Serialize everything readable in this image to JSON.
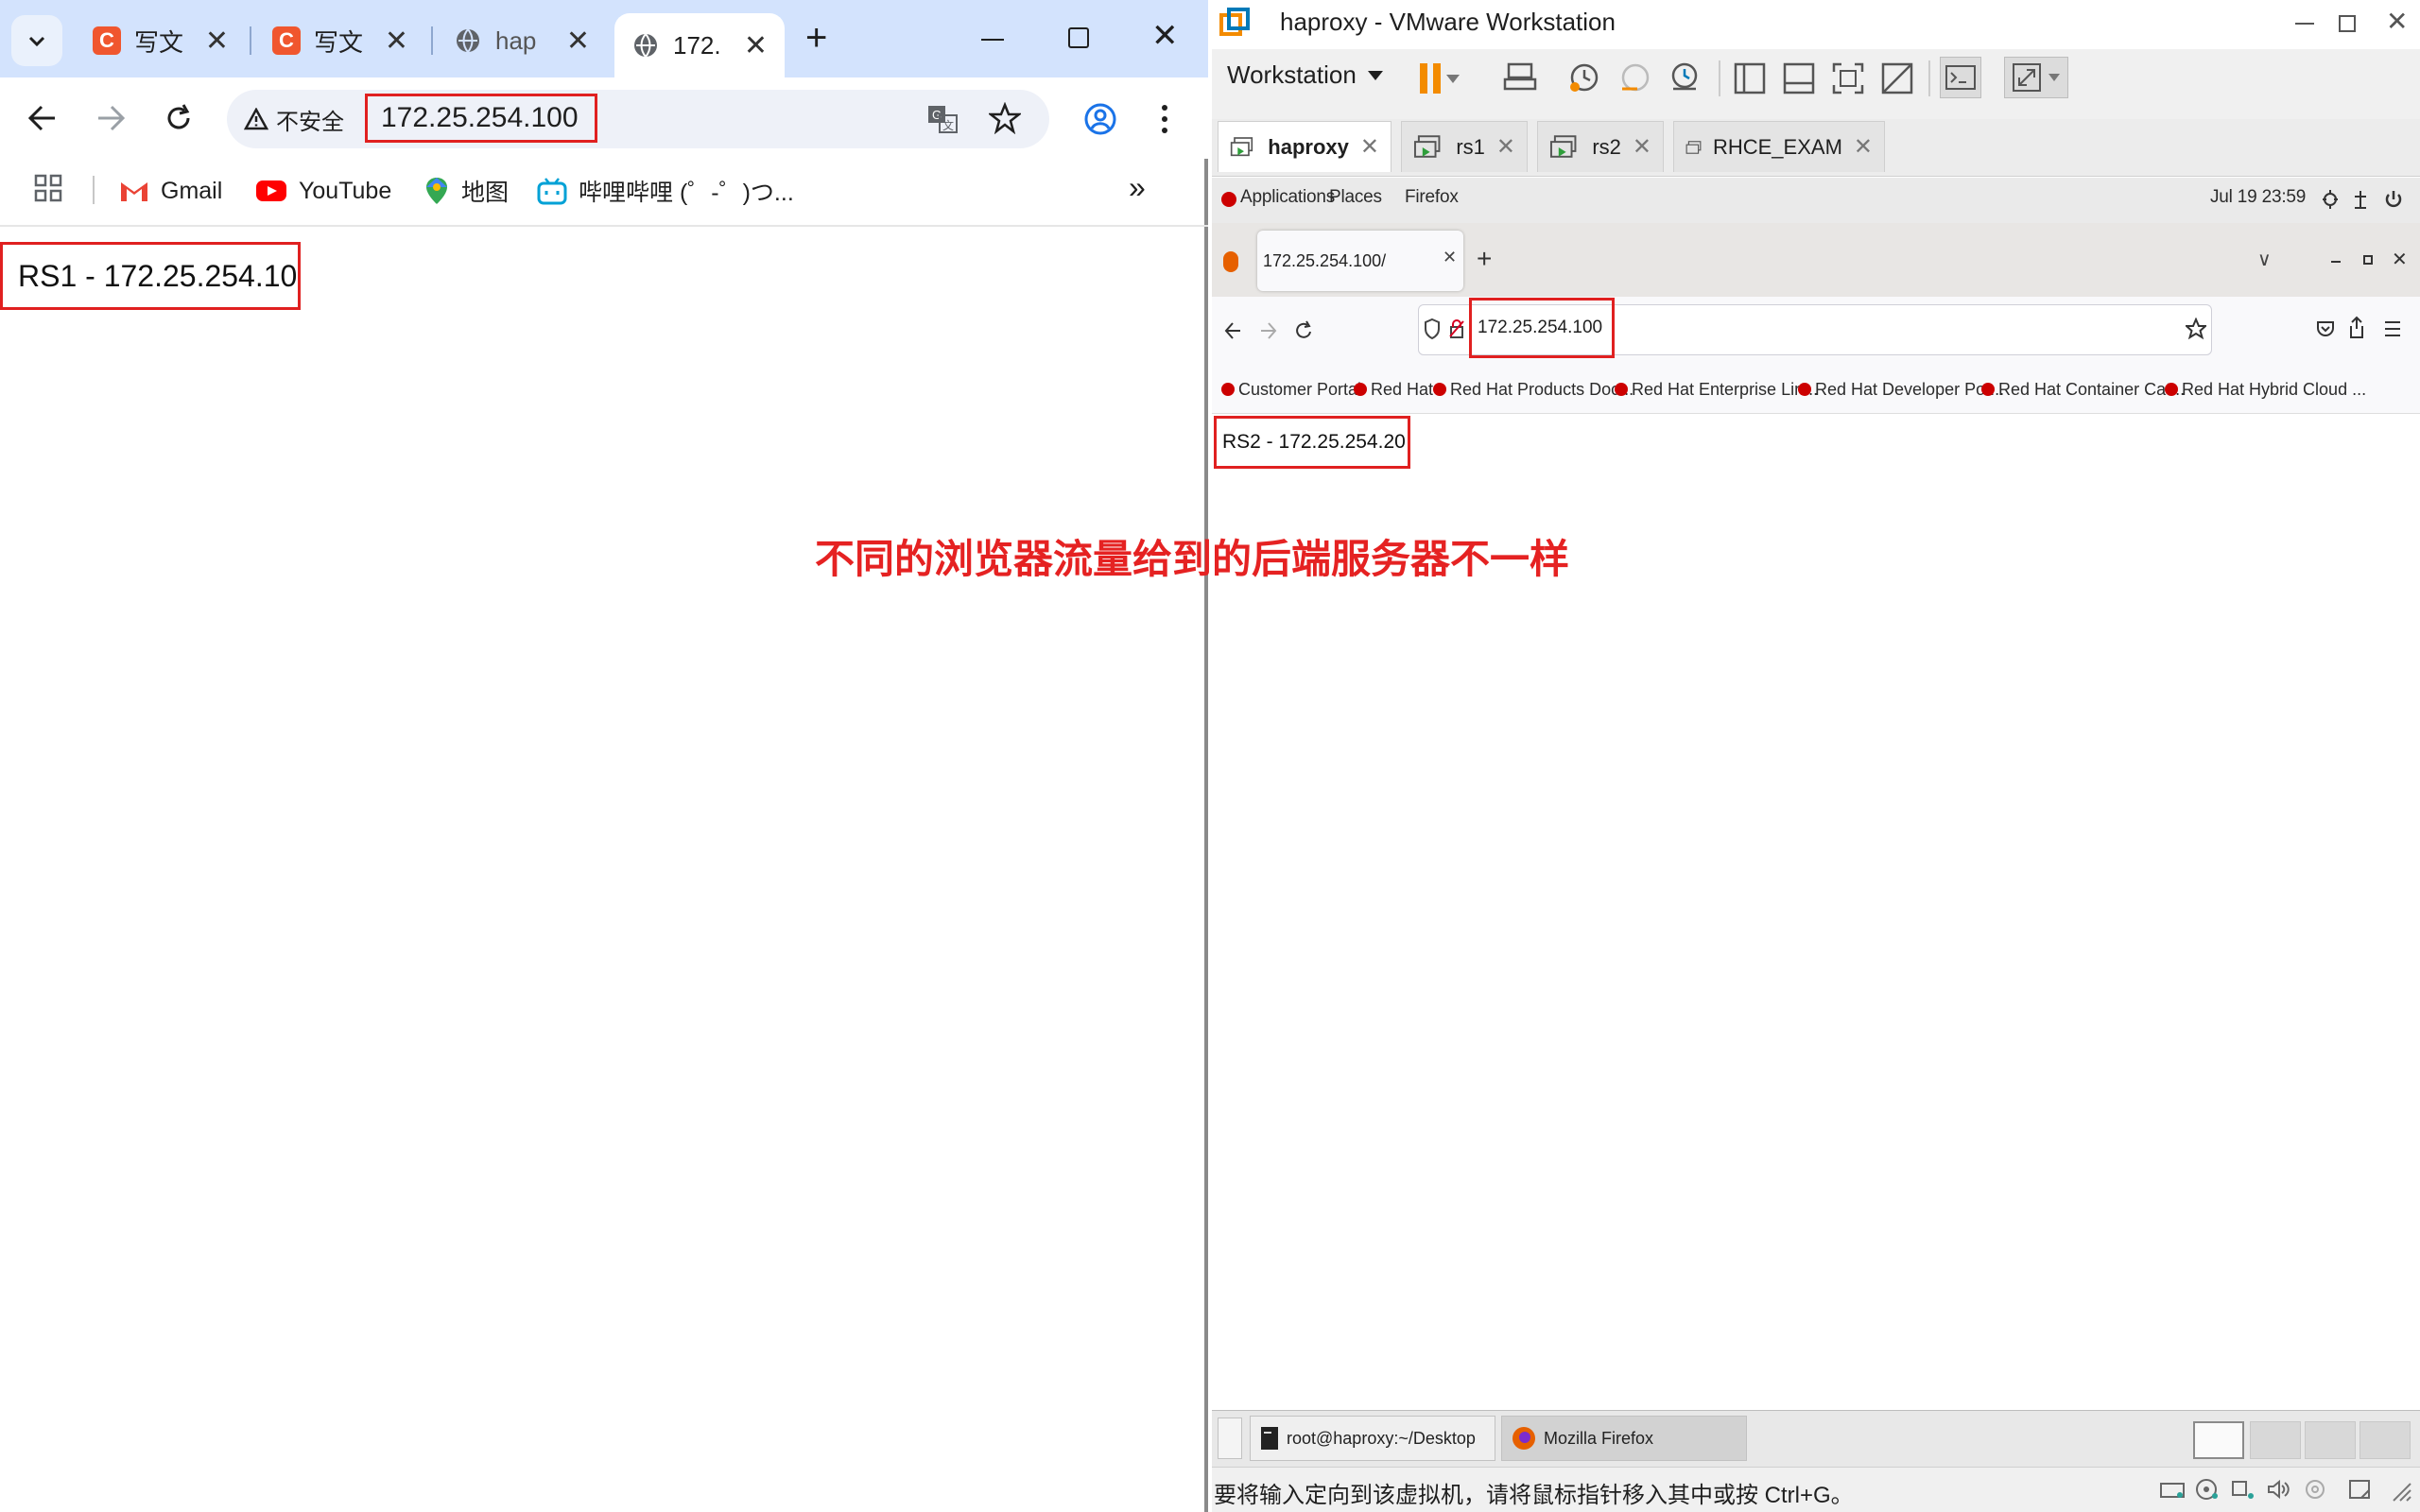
{
  "chrome": {
    "tabs": [
      {
        "label": "写文"
      },
      {
        "label": "写文"
      },
      {
        "label": "hap"
      },
      {
        "label": "172."
      }
    ],
    "omnibox": {
      "security_label": "不安全",
      "url": "172.25.254.100"
    },
    "bookmarks": [
      {
        "label": "Gmail"
      },
      {
        "label": "YouTube"
      },
      {
        "label": "地图"
      },
      {
        "label": "哔哩哔哩 (゜-゜)つ..."
      }
    ],
    "page": {
      "text": "RS1 - 172.25.254.10"
    }
  },
  "vmware": {
    "title": "haproxy - VMware Workstation",
    "menu_label": "Workstation",
    "tabs": [
      {
        "label": "haproxy",
        "active": true
      },
      {
        "label": "rs1"
      },
      {
        "label": "rs2"
      },
      {
        "label": "RHCE_EXAM"
      }
    ],
    "status_text": "要将输入定向到该虚拟机，请将鼠标指针移入其中或按 Ctrl+G。"
  },
  "guest": {
    "topbar": {
      "applications": "Applications",
      "places": "Places",
      "app_name": "Firefox",
      "clock": "Jul 19  23:59"
    },
    "firefox": {
      "tab_title": "172.25.254.100/",
      "url": "172.25.254.100",
      "bookmarks": [
        {
          "label": "Customer Portal"
        },
        {
          "label": "Red Hat"
        },
        {
          "label": "Red Hat Products Doc..."
        },
        {
          "label": "Red Hat Enterprise Lin..."
        },
        {
          "label": "Red Hat Developer Por..."
        },
        {
          "label": "Red Hat Container Cat..."
        },
        {
          "label": "Red Hat Hybrid Cloud ..."
        }
      ],
      "page_text": "RS2 - 172.25.254.20"
    },
    "taskbar": {
      "tasks": [
        {
          "label": "root@haproxy:~/Desktop"
        },
        {
          "label": "Mozilla Firefox"
        }
      ]
    }
  },
  "annotation": "不同的浏览器流量给到的后端服务器不一样",
  "colors": {
    "highlight_red": "#e02020",
    "annotation_red": "#e52222",
    "chrome_tabstrip": "#d3e3fd",
    "csdn_orange": "#f0562e"
  }
}
